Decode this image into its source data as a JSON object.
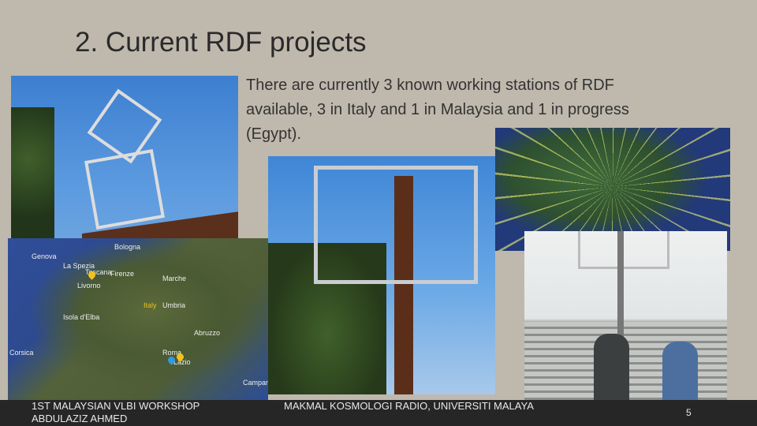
{
  "slide": {
    "title": "2. Current RDF projects",
    "body": "There are currently 3 known working stations of RDF available, 3 in Italy and 1 in Malaysia and 1 in progress (Egypt).",
    "map_labels": [
      "Genova",
      "La Spezia",
      "Bologna",
      "Firenze",
      "Toscana",
      "Livorno",
      "Marche",
      "Italy",
      "Umbria",
      "Abruzzo",
      "Roma",
      "Lazio",
      "Corsica",
      "Isola d'Elba",
      "Campania"
    ],
    "footer": {
      "event": "1ST MALAYSIAN VLBI WORKSHOP",
      "author": "ABDULAZIZ AHMED",
      "institution": "MAKMAL KOSMOLOGI RADIO, UNIVERSITI MALAYA",
      "page_number": "5"
    }
  }
}
